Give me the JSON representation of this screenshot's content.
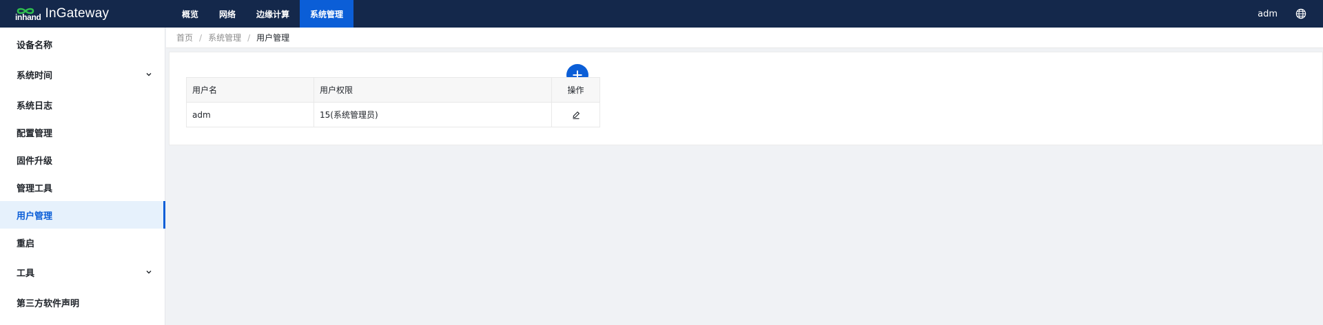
{
  "brand": {
    "logo_text": "inhand",
    "product_name": "InGateway"
  },
  "nav": [
    {
      "label": "概览",
      "active": false
    },
    {
      "label": "网络",
      "active": false
    },
    {
      "label": "边缘计算",
      "active": false
    },
    {
      "label": "系统管理",
      "active": true
    }
  ],
  "header": {
    "user": "adm",
    "language_icon": "globe-icon"
  },
  "sidebar": {
    "items": [
      {
        "label": "设备名称",
        "has_submenu": false
      },
      {
        "label": "系统时间",
        "has_submenu": true
      },
      {
        "label": "系统日志",
        "has_submenu": false
      },
      {
        "label": "配置管理",
        "has_submenu": false
      },
      {
        "label": "固件升级",
        "has_submenu": false
      },
      {
        "label": "管理工具",
        "has_submenu": false
      },
      {
        "label": "用户管理",
        "has_submenu": false,
        "active": true
      },
      {
        "label": "重启",
        "has_submenu": false
      },
      {
        "label": "工具",
        "has_submenu": true
      },
      {
        "label": "第三方软件声明",
        "has_submenu": false
      }
    ]
  },
  "breadcrumb": {
    "items": [
      "首页",
      "系统管理",
      "用户管理"
    ],
    "separator": "/"
  },
  "table": {
    "columns": [
      "用户名",
      "用户权限",
      "操作"
    ],
    "rows": [
      {
        "username": "adm",
        "permission": "15(系统管理员)",
        "action_icon": "edit-icon"
      }
    ]
  },
  "add_button": {
    "icon": "plus-icon"
  },
  "colors": {
    "topbar": "#14284b",
    "accent": "#0b5ed7",
    "sidebar_active_bg": "#e6f1fc",
    "page_bg": "#f0f2f5"
  }
}
